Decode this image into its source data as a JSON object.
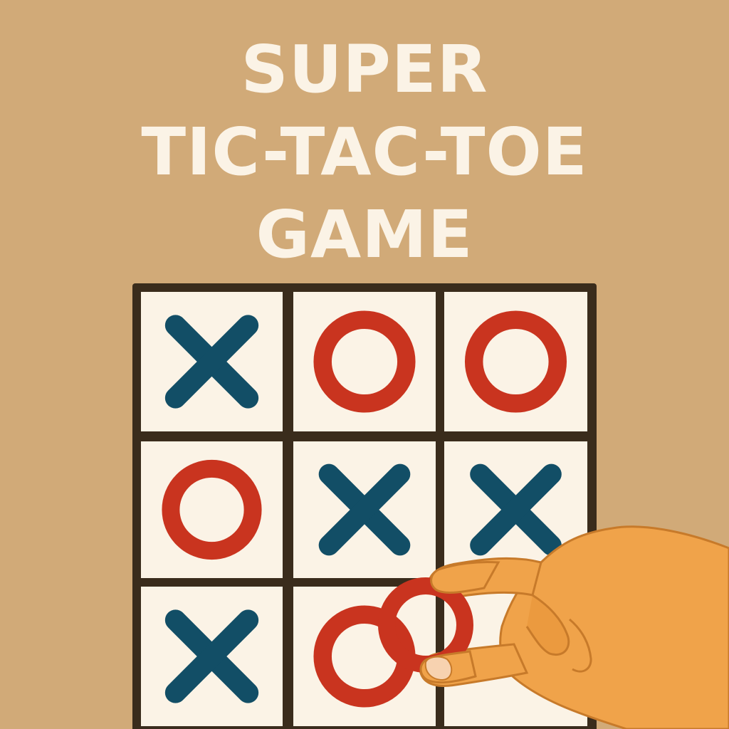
{
  "title": {
    "line1": "SUPER",
    "line2": "TIC-TAC-TOE",
    "line3": "GAME"
  },
  "colors": {
    "background": "#d1aa78",
    "board_frame": "#3a2c1c",
    "cell": "#fbf3e6",
    "x_mark": "#124e66",
    "o_mark": "#c9341f",
    "hand": "#f0a34a"
  },
  "board": {
    "cells": [
      [
        "X",
        "O",
        "O"
      ],
      [
        "O",
        "X",
        "X"
      ],
      [
        "X",
        "O",
        ""
      ]
    ]
  },
  "held_piece": {
    "mark": "O",
    "held_by": "hand-icon"
  }
}
